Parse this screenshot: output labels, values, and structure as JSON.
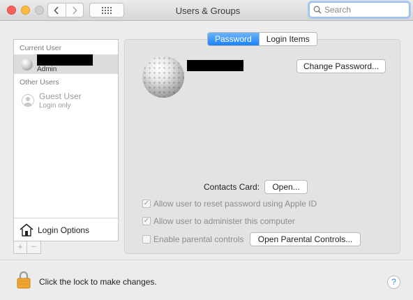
{
  "window": {
    "title": "Users & Groups",
    "search": {
      "placeholder": "Search",
      "value": ""
    }
  },
  "sidebar": {
    "current_user_label": "Current User",
    "current_user": {
      "name": "",
      "role": "Admin"
    },
    "other_users_label": "Other Users",
    "guest": {
      "name": "Guest User",
      "sub": "Login only"
    },
    "login_options_label": "Login Options",
    "add_label": "+",
    "remove_label": "−"
  },
  "tabs": [
    {
      "label": "Password",
      "active": true
    },
    {
      "label": "Login Items",
      "active": false
    }
  ],
  "main": {
    "user_name": "",
    "change_password_label": "Change Password...",
    "contacts_card_label": "Contacts Card:",
    "open_label": "Open...",
    "checkboxes": [
      {
        "label": "Allow user to reset password using Apple ID",
        "checked": true
      },
      {
        "label": "Allow user to administer this computer",
        "checked": true
      },
      {
        "label": "Enable parental controls",
        "checked": false
      }
    ],
    "open_parental_controls_label": "Open Parental Controls..."
  },
  "footer": {
    "lock_text": "Click the lock to make changes.",
    "help_label": "?"
  },
  "colors": {
    "accent": "#1a82fb",
    "close": "#fc605c",
    "minimize": "#fdbc40",
    "lock": "#f0a630"
  }
}
